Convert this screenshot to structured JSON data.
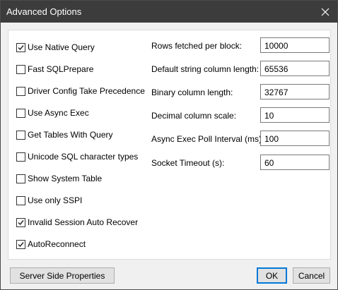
{
  "window": {
    "title": "Advanced Options"
  },
  "options": [
    {
      "label": "Use Native Query",
      "checked": true
    },
    {
      "label": "Fast SQLPrepare",
      "checked": false
    },
    {
      "label": "Driver Config Take Precedence",
      "checked": false
    },
    {
      "label": "Use Async Exec",
      "checked": false
    },
    {
      "label": "Get Tables With Query",
      "checked": false
    },
    {
      "label": "Unicode SQL character types",
      "checked": false
    },
    {
      "label": "Show System Table",
      "checked": false
    },
    {
      "label": "Use only SSPI",
      "checked": false
    },
    {
      "label": "Invalid Session Auto Recover",
      "checked": true
    },
    {
      "label": "AutoReconnect",
      "checked": true
    }
  ],
  "fields": [
    {
      "label": "Rows fetched per block:",
      "value": "10000"
    },
    {
      "label": "Default string column length:",
      "value": "65536"
    },
    {
      "label": "Binary column length:",
      "value": "32767"
    },
    {
      "label": "Decimal column scale:",
      "value": "10"
    },
    {
      "label": "Async Exec Poll Interval (ms):",
      "value": "100"
    },
    {
      "label": "Socket Timeout (s):",
      "value": "60"
    }
  ],
  "buttons": {
    "server_side": "Server Side Properties",
    "ok": "OK",
    "cancel": "Cancel"
  }
}
